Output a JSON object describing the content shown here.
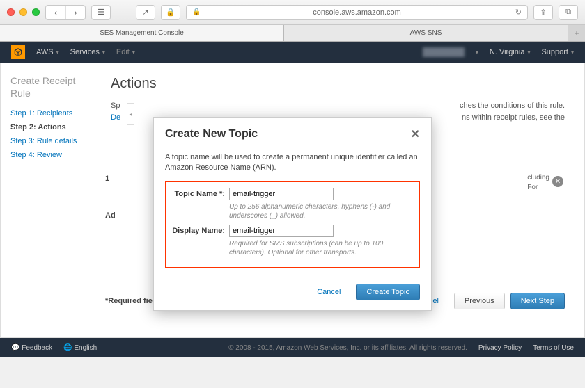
{
  "browser": {
    "url": "console.aws.amazon.com",
    "tabs": [
      "SES Management Console",
      "AWS SNS"
    ]
  },
  "aws_header": {
    "brand": "AWS",
    "services": "Services",
    "edit": "Edit",
    "region": "N. Virginia",
    "support": "Support"
  },
  "sidebar": {
    "title": "Create Receipt Rule",
    "steps": [
      "Step 1: Recipients",
      "Step 2: Actions",
      "Step 3: Rule details",
      "Step 4: Review"
    ]
  },
  "main": {
    "heading": "Actions",
    "desc_fragment_1": "Sp",
    "desc_fragment_2": "De",
    "desc_right_1": "ches the conditions of this rule.",
    "desc_right_2": "ns within receipt rules, see the",
    "side_hint_1": "cluding",
    "side_hint_2": "For",
    "one": "1",
    "add_action_label": "Ad",
    "required": "*Required fields",
    "cancel": "Cancel",
    "previous": "Previous",
    "next": "Next Step"
  },
  "modal": {
    "title": "Create New Topic",
    "close": "✕",
    "desc": "A topic name will be used to create a permanent unique identifier called an Amazon Resource Name (ARN).",
    "topic_name_label": "Topic Name *:",
    "topic_name_value": "email-trigger",
    "topic_name_hint": "Up to 256 alphanumeric characters, hyphens (-) and underscores (_) allowed.",
    "display_name_label": "Display Name:",
    "display_name_value": "email-trigger",
    "display_name_hint": "Required for SMS subscriptions (can be up to 100 characters). Optional for other transports.",
    "cancel": "Cancel",
    "create": "Create Topic"
  },
  "footer": {
    "feedback": "Feedback",
    "language": "English",
    "copyright": "© 2008 - 2015, Amazon Web Services, Inc. or its affiliates. All rights reserved.",
    "privacy": "Privacy Policy",
    "terms": "Terms of Use"
  }
}
